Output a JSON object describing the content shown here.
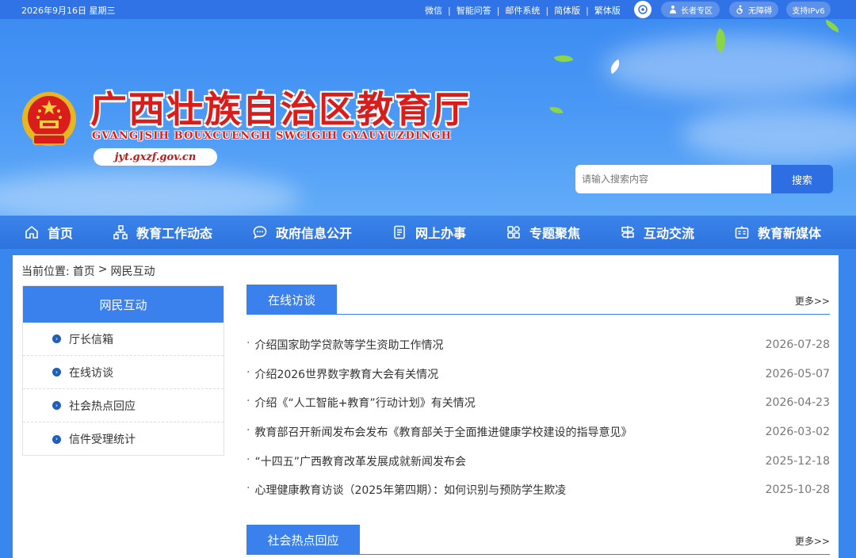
{
  "topbar": {
    "date": "2026年9月16日  星期三",
    "links": [
      "微信",
      "智能问答",
      "邮件系统",
      "简体版",
      "繁体版"
    ],
    "elder_zone": "长者专区",
    "accessible": "无障碍",
    "ipv6": "支持IPv6"
  },
  "header": {
    "title": "广西壮族自治区教育厅",
    "subtitle": "GVANGJSIH BOUXCUENGH SWCIGIH GYAUYUZDINGH",
    "domain": "jyt.gxzf.gov.cn"
  },
  "search": {
    "placeholder": "请输入搜索内容",
    "button": "搜索"
  },
  "nav": [
    {
      "label": "首页",
      "icon": "home-icon"
    },
    {
      "label": "教育工作动态",
      "icon": "org-chart-icon"
    },
    {
      "label": "政府信息公开",
      "icon": "chat-icon"
    },
    {
      "label": "网上办事",
      "icon": "document-icon"
    },
    {
      "label": "专题聚焦",
      "icon": "grid-icon"
    },
    {
      "label": "互动交流",
      "icon": "signpost-icon"
    },
    {
      "label": "教育新媒体",
      "icon": "media-icon"
    }
  ],
  "breadcrumb": {
    "prefix": "当前位置:",
    "home": "首页",
    "sep": ">",
    "current": "网民互动"
  },
  "sidebar": {
    "title": "网民互动",
    "items": [
      "厅长信箱",
      "在线访谈",
      "社会热点回应",
      "信件受理统计"
    ]
  },
  "online_interview": {
    "tab": "在线访谈",
    "more": "更多>>",
    "items": [
      {
        "title": "介绍国家助学贷款等学生资助工作情况",
        "date": "2026-07-28"
      },
      {
        "title": "介绍2026世界数字教育大会有关情况",
        "date": "2026-05-07"
      },
      {
        "title": "介绍《“人工智能+教育”行动计划》有关情况",
        "date": "2026-04-23"
      },
      {
        "title": "教育部召开新闻发布会发布《教育部关于全面推进健康学校建设的指导意见》",
        "date": "2026-03-02"
      },
      {
        "title": "“十四五”广西教育改革发展成就新闻发布会",
        "date": "2025-12-18"
      },
      {
        "title": "心理健康教育访谈（2025年第四期）：如何识别与预防学生欺凌",
        "date": "2025-10-28"
      }
    ]
  },
  "hot_response": {
    "tab": "社会热点回应",
    "more": "更多>>"
  },
  "colors": {
    "primary": "#3a81ee",
    "topbar": "#2f73e6",
    "title_red": "#d91c1c"
  }
}
